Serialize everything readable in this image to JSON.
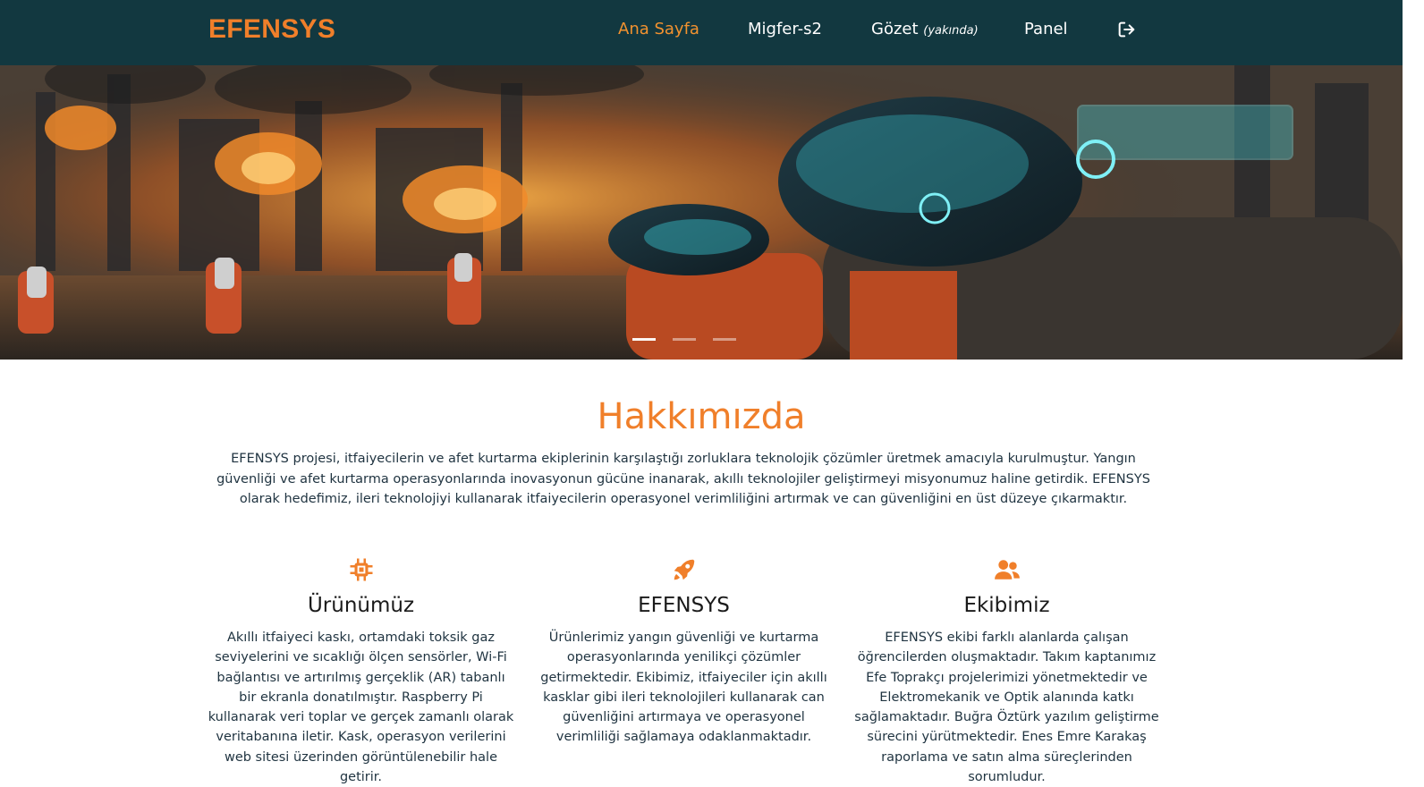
{
  "navbar": {
    "brand": "EFENSYS",
    "items": [
      {
        "label": "Ana Sayfa",
        "active": true
      },
      {
        "label": "Migfer-s2",
        "active": false
      },
      {
        "label": "Gözet",
        "suffix": "(yakında)",
        "active": false
      },
      {
        "label": "Panel",
        "active": false
      }
    ],
    "logout_icon": "logout-icon"
  },
  "hero": {
    "slide_count": 3,
    "active_slide": 1
  },
  "about": {
    "title": "Hakkımızda",
    "text": "EFENSYS projesi, itfaiyecilerin ve afet kurtarma ekiplerinin karşılaştığı zorluklara teknolojik çözümler üretmek amacıyla kurulmuştur. Yangın güvenliği ve afet kurtarma operasyonlarında inovasyonun gücüne inanarak, akıllı teknolojiler geliştirmeyi misyonumuz haline getirdik. EFENSYS olarak hedefimiz, ileri teknolojiyi kullanarak itfaiyecilerin operasyonel verimliliğini artırmak ve can güvenliğini en üst düzeye çıkarmaktır."
  },
  "features": [
    {
      "icon": "microchip-icon",
      "title": "Ürünümüz",
      "text": "Akıllı itfaiyeci kaskı, ortamdaki toksik gaz seviyelerini ve sıcaklığı ölçen sensörler, Wi-Fi bağlantısı ve artırılmış gerçeklik (AR) tabanlı bir ekranla donatılmıştır. Raspberry Pi kullanarak veri toplar ve gerçek zamanlı olarak veritabanına iletir. Kask, operasyon verilerini web sitesi üzerinden görüntülenebilir hale getirir."
    },
    {
      "icon": "rocket-icon",
      "title": "EFENSYS",
      "text": "Ürünlerimiz yangın güvenliği ve kurtarma operasyonlarında yenilikçi çözümler getirmektedir. Ekibimiz, itfaiyeciler için akıllı kasklar gibi ileri teknolojileri kullanarak can güvenliğini artırmaya ve operasyonel verimliliği sağlamaya odaklanmaktadır."
    },
    {
      "icon": "users-icon",
      "title": "Ekibimiz",
      "text": "EFENSYS ekibi farklı alanlarda çalışan öğrencilerden oluşmaktadır. Takım kaptanımız Efe Toprakçı projelerimizi yönetmektedir ve Elektromekanik ve Optik alanında katkı sağlamaktadır. Buğra Öztürk yazılım geliştirme sürecini yürütmektedir. Enes Emre Karakaş raporlama ve satın alma süreçlerinden sorumludur."
    }
  ],
  "colors": {
    "navbar_bg": "#123840",
    "accent": "#f07f2a",
    "text": "#1f3340"
  }
}
